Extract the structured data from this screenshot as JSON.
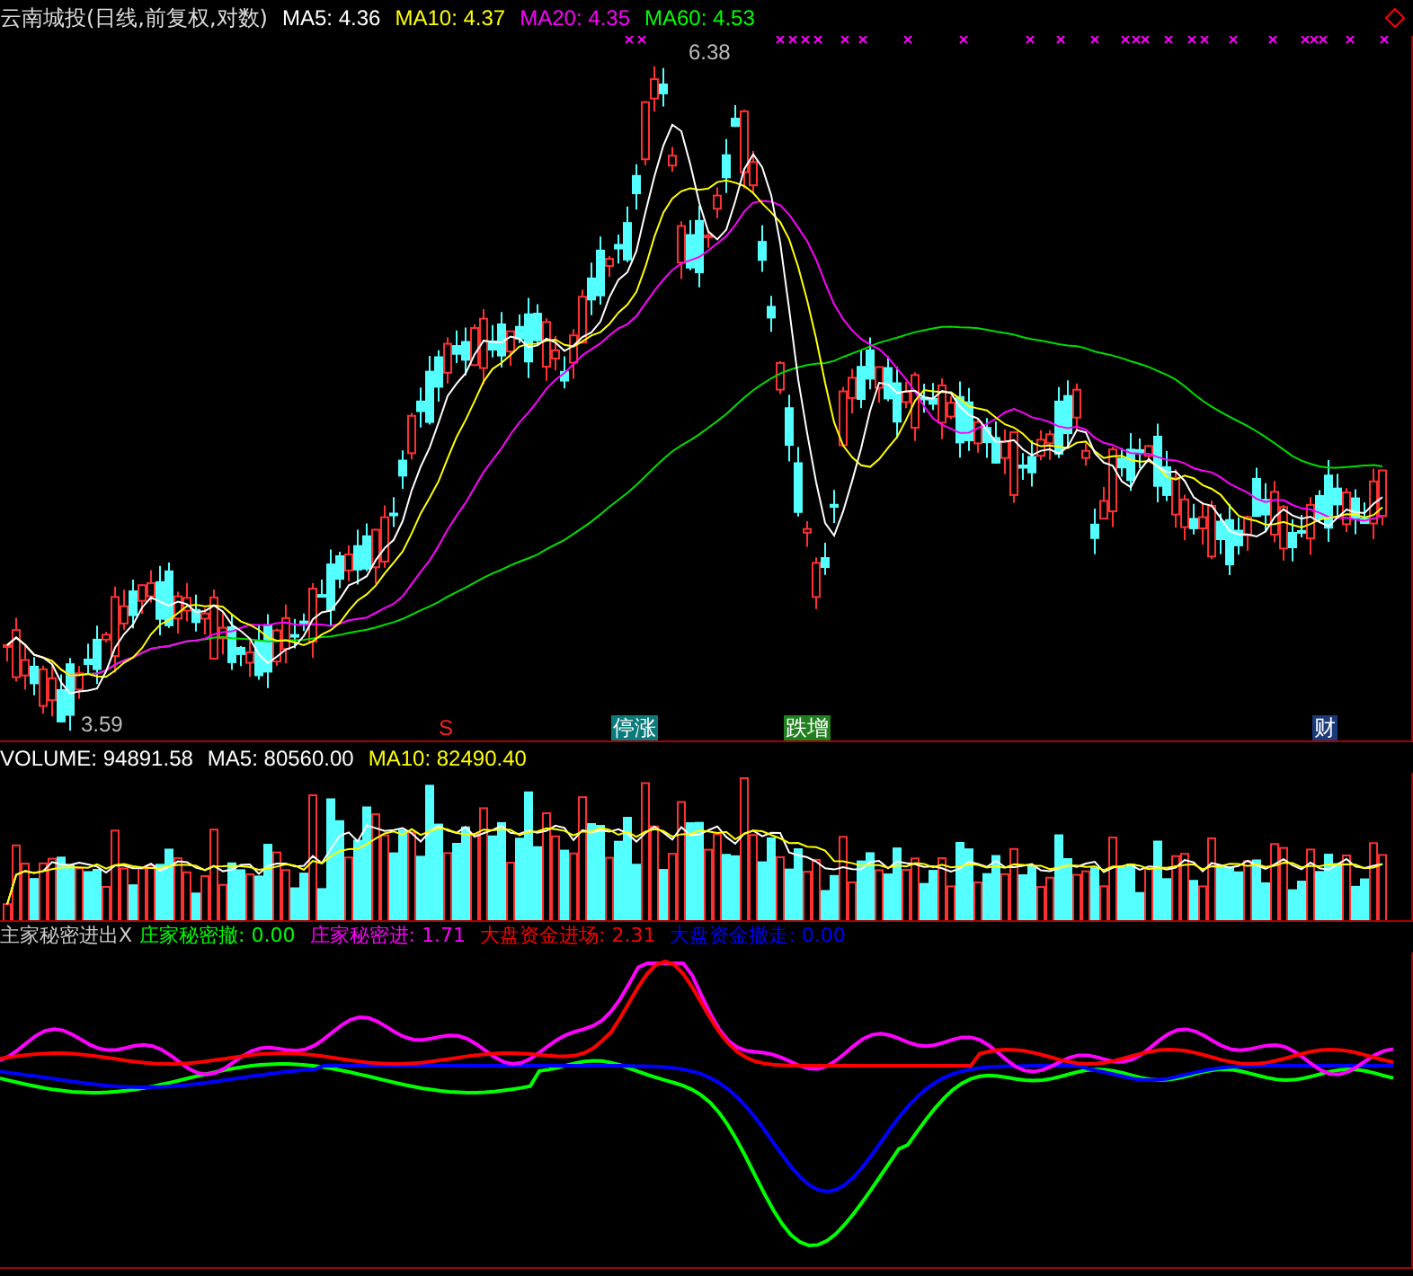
{
  "price_panel": {
    "title": "云南城投(日线,前复权,对数)",
    "indicators": [
      {
        "label": "MA5:",
        "value": "4.36",
        "color": "#ffffff"
      },
      {
        "label": "MA10:",
        "value": "4.37",
        "color": "#ffff00"
      },
      {
        "label": "MA20:",
        "value": "4.35",
        "color": "#ff00ff"
      },
      {
        "label": "MA60:",
        "value": "4.53",
        "color": "#00ff00"
      }
    ],
    "high_label": "6.38",
    "low_label": "3.59",
    "markers": [
      {
        "text": "S",
        "kind": "signal"
      },
      {
        "text": "停涨",
        "kind": "pair"
      },
      {
        "text": "跌增",
        "kind": "pair"
      },
      {
        "text": "财",
        "kind": "single"
      }
    ]
  },
  "volume_panel": {
    "indicators": [
      {
        "label": "VOLUME:",
        "value": "94891.58",
        "color": "#ffffff"
      },
      {
        "label": "MA5:",
        "value": "80560.00",
        "color": "#ffffff"
      },
      {
        "label": "MA10:",
        "value": "82490.40",
        "color": "#ffff00"
      }
    ]
  },
  "indicator_panel": {
    "title": "主家秘密进出X",
    "indicators": [
      {
        "label": "庄家秘密撤:",
        "value": "0.00",
        "color": "#00ff00"
      },
      {
        "label": "庄家秘密进:",
        "value": "1.71",
        "color": "#ff00ff"
      },
      {
        "label": "大盘资金进场:",
        "value": "2.31",
        "color": "#ff0000"
      },
      {
        "label": "大盘资金撤走:",
        "value": "0.00",
        "color": "#0000ff"
      }
    ]
  }
}
